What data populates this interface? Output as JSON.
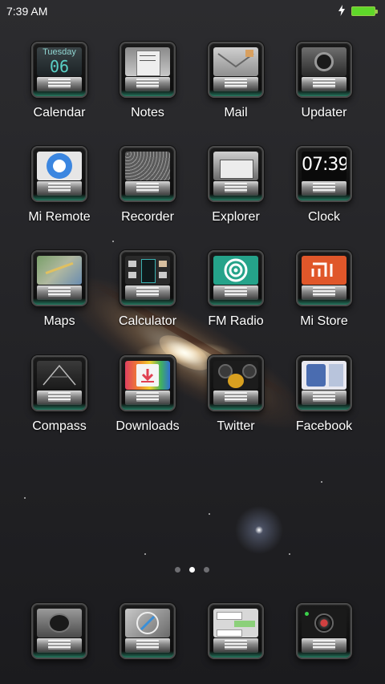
{
  "status_bar": {
    "time": "7:39 AM",
    "charge_icon": "lightning-icon",
    "battery_icon": "battery-full-icon",
    "battery_color": "#5fd82a"
  },
  "calendar_tile": {
    "weekday": "Tuesday",
    "day": "06"
  },
  "clock_tile": {
    "time": "07:39"
  },
  "apps": [
    {
      "label": "Calendar",
      "icon": "calendar-icon"
    },
    {
      "label": "Notes",
      "icon": "notes-icon"
    },
    {
      "label": "Mail",
      "icon": "mail-icon"
    },
    {
      "label": "Updater",
      "icon": "updater-icon"
    },
    {
      "label": "Mi Remote",
      "icon": "remote-icon"
    },
    {
      "label": "Recorder",
      "icon": "recorder-icon"
    },
    {
      "label": "Explorer",
      "icon": "explorer-icon"
    },
    {
      "label": "Clock",
      "icon": "clock-icon"
    },
    {
      "label": "Maps",
      "icon": "maps-icon"
    },
    {
      "label": "Calculator",
      "icon": "calculator-icon"
    },
    {
      "label": "FM Radio",
      "icon": "radio-icon"
    },
    {
      "label": "Mi Store",
      "icon": "mi-store-icon"
    },
    {
      "label": "Compass",
      "icon": "compass-icon"
    },
    {
      "label": "Downloads",
      "icon": "downloads-icon"
    },
    {
      "label": "Twitter",
      "icon": "twitter-icon"
    },
    {
      "label": "Facebook",
      "icon": "facebook-icon"
    }
  ],
  "pager": {
    "pages": 3,
    "current": 2
  },
  "dock": [
    {
      "icon": "phone-icon"
    },
    {
      "icon": "browser-icon"
    },
    {
      "icon": "messages-icon"
    },
    {
      "icon": "camera-icon"
    }
  ]
}
